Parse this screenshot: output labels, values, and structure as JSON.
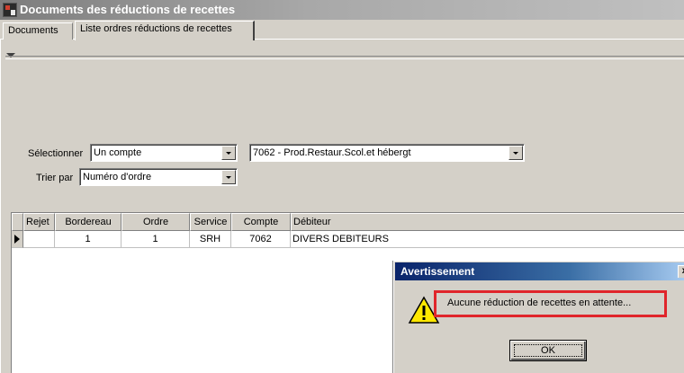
{
  "window": {
    "title": "Documents des réductions de recettes"
  },
  "tabs": [
    {
      "label": "Documents"
    },
    {
      "label": "Liste ordres réductions de recettes"
    }
  ],
  "filters": {
    "select_label": "Sélectionner",
    "select_value": "Un compte",
    "account_value": "7062 - Prod.Restaur.Scol.et hébergt",
    "sort_label": "Trier par",
    "sort_value": "Numéro d'ordre"
  },
  "grid": {
    "columns": [
      "Rejet",
      "Bordereau",
      "Ordre",
      "Service",
      "Compte",
      "Débiteur"
    ],
    "rows": [
      {
        "rejet": "",
        "bordereau": "1",
        "ordre": "1",
        "service": "SRH",
        "compte": "7062",
        "debiteur": "DIVERS DEBITEURS"
      }
    ]
  },
  "dialog": {
    "title": "Avertissement",
    "message": "Aucune réduction de recettes en attente...",
    "ok_label": "OK",
    "close_glyph": "x",
    "icon": "warning-icon"
  },
  "icons": {
    "app": "app-icon",
    "dropdown": "chevron-down-icon",
    "row_pointer": "row-pointer-icon"
  }
}
